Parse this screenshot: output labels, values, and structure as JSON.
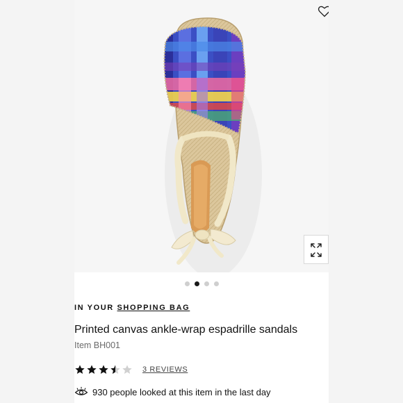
{
  "product": {
    "shopping_bag_prefix": "IN YOUR",
    "shopping_bag_link": "SHOPPING BAG",
    "title": "Printed canvas ankle-wrap espadrille sandals",
    "item_number": "Item BH001",
    "rating": {
      "stars_filled": 3.5,
      "stars_total": 5
    },
    "reviews_link": "3 REVIEWS",
    "viewers_text": "930 people looked at this item in the last day"
  },
  "gallery": {
    "image_count": 4,
    "active_index": 1
  },
  "icons": {
    "wishlist": "heart-outline-icon",
    "expand": "expand-arrows-icon",
    "eye": "eye-icon",
    "star": "star-icon"
  },
  "colors": {
    "text": "#111111",
    "muted": "#6a6a6a",
    "dot_active": "#1a1a1a",
    "dot_inactive": "#cfcfcf"
  }
}
